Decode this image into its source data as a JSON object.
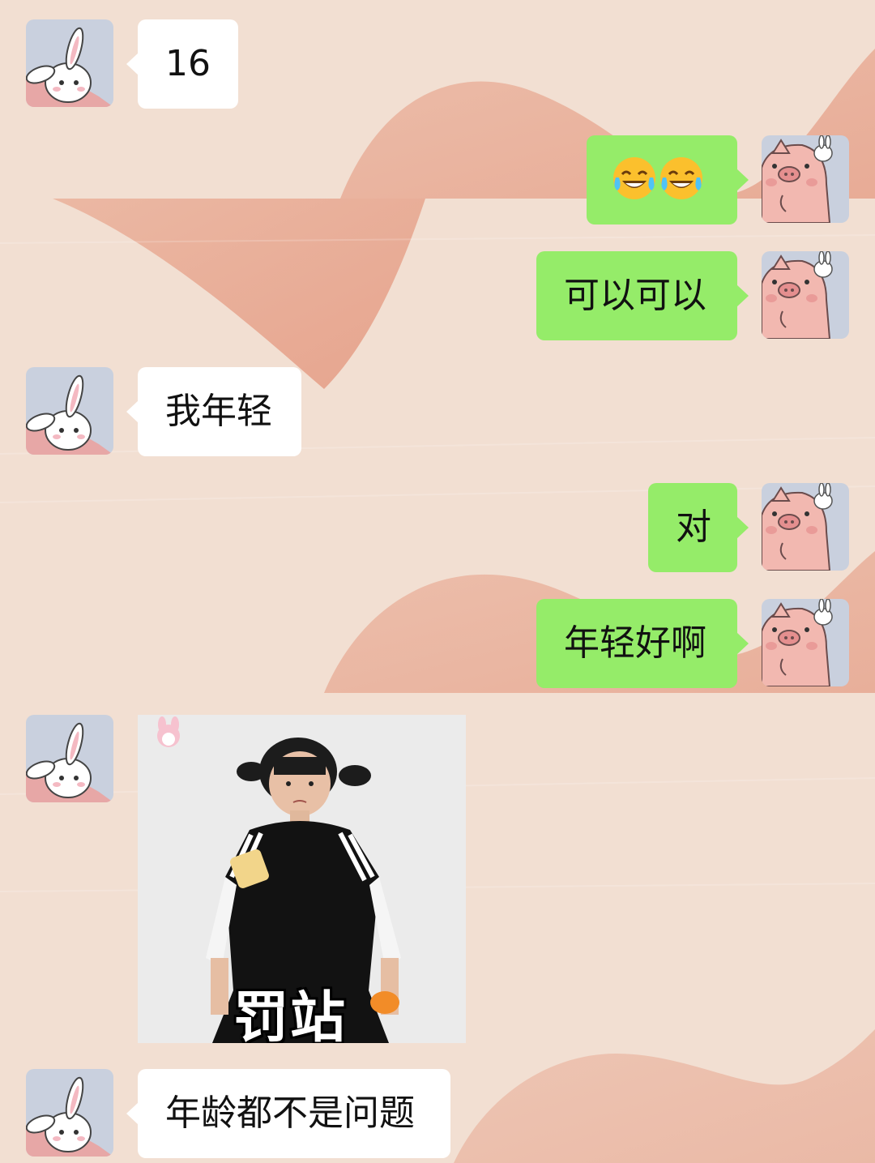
{
  "messages": [
    {
      "side": "left",
      "text": "16"
    },
    {
      "side": "right",
      "emoji": [
        "tears-of-joy-icon",
        "tears-of-joy-icon"
      ]
    },
    {
      "side": "right",
      "text": "可以可以"
    },
    {
      "side": "left",
      "text": "我年轻"
    },
    {
      "side": "right",
      "text": "对"
    },
    {
      "side": "right",
      "text": "年轻好啊"
    },
    {
      "side": "left",
      "sticker": {
        "caption": "罚站"
      }
    },
    {
      "side": "left",
      "text": "年龄都不是问题"
    }
  ],
  "colors": {
    "self_bubble": "#95ec69",
    "other_bubble": "#ffffff",
    "background": "#f2dfd2",
    "brush_stroke": "#e9a58d"
  }
}
